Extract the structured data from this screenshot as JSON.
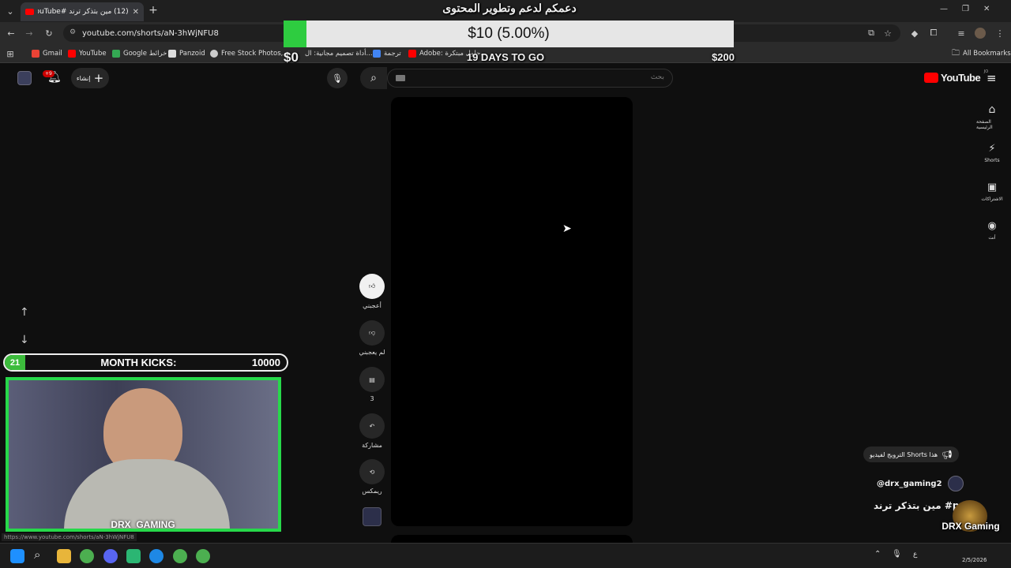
{
  "browser": {
    "tab_title": "(12) مين بتذكر ترند #YouTube",
    "tab_new": "+",
    "url": "youtube.com/shorts/aN-3hWjNFU8",
    "window_controls": [
      "—",
      "❐",
      "✕"
    ],
    "bookmarks": [
      {
        "label": "Gmail",
        "color": "#ea4335"
      },
      {
        "label": "YouTube",
        "color": "#ff0000"
      },
      {
        "label": "Google خرائط",
        "color": "#34a853"
      },
      {
        "label": "Panzoid",
        "color": "#dddddd"
      },
      {
        "label": "Free Stock Photos,...",
        "color": "#cccccc"
      },
      {
        "label": "أداة تصميم مجانية: ال...",
        "color": "#00c4cc"
      },
      {
        "label": "ترجمة",
        "color": "#4285f4"
      },
      {
        "label": "Adobe: حلول مبتكرة...",
        "color": "#ff0000"
      }
    ],
    "all_bookmarks": "All Bookmarks",
    "status_url": "https://www.youtube.com/shorts/aN-3hWjNFU8"
  },
  "donation": {
    "headline": "دعمكم لدعم وتطوير المحتوى",
    "amount_text": "$10 (5.00%)",
    "progress": 0.05,
    "min_label": "$0",
    "max_label": "$200",
    "days_left": "19 DAYS TO GO"
  },
  "youtube": {
    "create_label": "إنشاء",
    "notification_count": "+9",
    "search_placeholder": "بحث",
    "logo_text": "YouTube",
    "logo_region": "JO",
    "sidebar": [
      {
        "label": "الصفحة الرئيسية",
        "icon": "home-icon"
      },
      {
        "label": "Shorts",
        "icon": "shorts-icon"
      },
      {
        "label": "الاشتراكات",
        "icon": "subscriptions-icon"
      },
      {
        "label": "أنت",
        "icon": "you-icon"
      }
    ],
    "actions": {
      "like": "أعجبني",
      "dislike": "لم يعجبني",
      "comments_count": "3",
      "share": "مشاركة",
      "remix": "ريمكس"
    },
    "promote": "الترويج لفيديو Shorts هذا",
    "channel": "@drx_gaming2",
    "title": "مين بتذكر ترند #pubg"
  },
  "overlay": {
    "kicks_badge": "21",
    "kicks_label": "MONTH KICKS:",
    "kicks_value": "10000",
    "streamer_name": "DRX_GAMING",
    "logo_text": "DRX Gaming"
  },
  "taskbar": {
    "lang": "ع",
    "date": "2/5/2026"
  },
  "colors": {
    "yt_red": "#ff0000",
    "overlay_green": "#27d84a",
    "donation_green": "#2ecc40"
  }
}
